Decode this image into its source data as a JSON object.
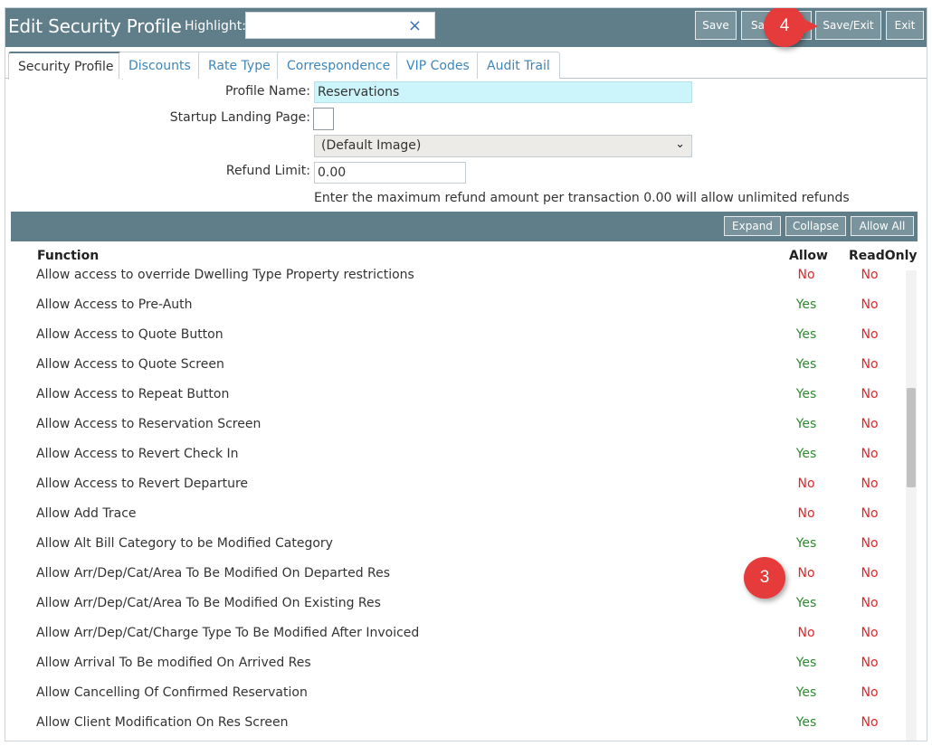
{
  "header": {
    "title": "Edit Security Profile",
    "highlight_label": "Highlight:",
    "highlight_value": "",
    "clear_glyph": "×",
    "buttons": {
      "save": "Save",
      "save_new_partial": "Sa",
      "save_exit": "Save/Exit",
      "exit": "Exit"
    }
  },
  "callouts": {
    "step4": "4",
    "step3": "3"
  },
  "tabs": [
    "Security Profile",
    "Discounts",
    "Rate Type",
    "Correspondence",
    "VIP Codes",
    "Audit Trail"
  ],
  "form": {
    "profile_name_label": "Profile Name:",
    "profile_name_value": "Reservations",
    "startup_label": "Startup Landing Page:",
    "image_select": "(Default Image)",
    "refund_label": "Refund Limit:",
    "refund_value": "0.00",
    "refund_hint": "Enter the maximum refund amount per transaction 0.00 will allow unlimited refunds"
  },
  "grid": {
    "buttons": {
      "expand": "Expand",
      "collapse": "Collapse",
      "allow_all": "Allow All"
    },
    "columns": {
      "function": "Function",
      "allow": "Allow",
      "readonly": "ReadOnly"
    },
    "rows": [
      {
        "name": "Allow access to override Dwelling Type Property restrictions",
        "allow": "No",
        "readonly": "No"
      },
      {
        "name": "Allow Access to Pre-Auth",
        "allow": "Yes",
        "readonly": "No"
      },
      {
        "name": "Allow Access to Quote Button",
        "allow": "Yes",
        "readonly": "No"
      },
      {
        "name": "Allow Access to Quote Screen",
        "allow": "Yes",
        "readonly": "No"
      },
      {
        "name": "Allow Access to Repeat Button",
        "allow": "Yes",
        "readonly": "No"
      },
      {
        "name": "Allow Access to Reservation Screen",
        "allow": "Yes",
        "readonly": "No"
      },
      {
        "name": "Allow Access to Revert Check In",
        "allow": "Yes",
        "readonly": "No"
      },
      {
        "name": "Allow Access to Revert Departure",
        "allow": "No",
        "readonly": "No"
      },
      {
        "name": "Allow Add Trace",
        "allow": "No",
        "readonly": "No"
      },
      {
        "name": "Allow Alt Bill Category to be Modified Category",
        "allow": "Yes",
        "readonly": "No"
      },
      {
        "name": "Allow Arr/Dep/Cat/Area To Be Modified On Departed Res",
        "allow": "No",
        "readonly": "No"
      },
      {
        "name": "Allow Arr/Dep/Cat/Area To Be Modified On Existing Res",
        "allow": "Yes",
        "readonly": "No"
      },
      {
        "name": "Allow Arr/Dep/Cat/Charge Type To Be Modified After Invoiced",
        "allow": "No",
        "readonly": "No"
      },
      {
        "name": "Allow Arrival To Be modified On Arrived Res",
        "allow": "Yes",
        "readonly": "No"
      },
      {
        "name": "Allow Cancelling Of Confirmed Reservation",
        "allow": "Yes",
        "readonly": "No"
      },
      {
        "name": "Allow Client Modification On Res Screen",
        "allow": "Yes",
        "readonly": "No"
      }
    ]
  },
  "colors": {
    "header_bg": "#5f7e89",
    "yes": "#2f8a2f",
    "no": "#e0262b",
    "callout": "#e53b3b",
    "tab_link": "#3e86b8"
  }
}
